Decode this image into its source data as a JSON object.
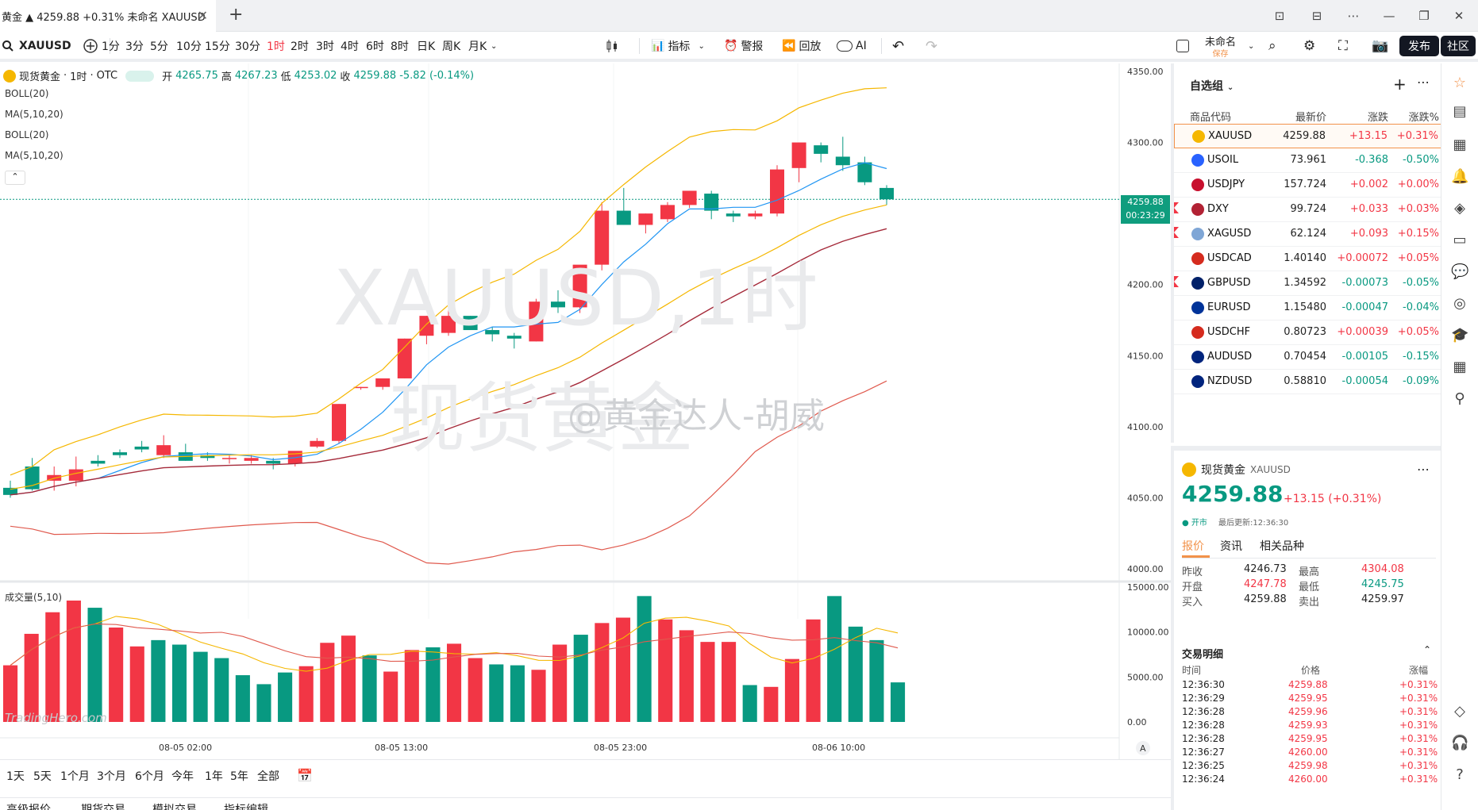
{
  "tab": {
    "title": "黄金 ▲ 4259.88 +0.31% 未命名 XAUUSD",
    "new_tab": "+",
    "close": "✕"
  },
  "window_controls": [
    "⊡",
    "⊟",
    "⋯",
    "—",
    "❐",
    "✕"
  ],
  "toolbar": {
    "symbol": "XAUUSD",
    "intervals": [
      "1分",
      "3分",
      "5分",
      "10分",
      "15分",
      "30分",
      "1时",
      "2时",
      "3时",
      "4时",
      "6时",
      "8时",
      "日K",
      "周K",
      "月K"
    ],
    "active_interval": "1时",
    "indicators": "指标",
    "alert": "警报",
    "replay": "回放",
    "ai": "AI",
    "layout_name": "未命名",
    "layout_sub": "保存",
    "publish": "发布",
    "community": "社区"
  },
  "legend": {
    "name": "现货黄金",
    "interval": "1时",
    "exchange": "OTC",
    "open_label": "开",
    "open": "4265.75",
    "high_label": "高",
    "high": "4267.23",
    "low_label": "低",
    "low": "4253.02",
    "close_label": "收",
    "close": "4259.88",
    "change": "-5.82 (-0.14%)"
  },
  "indicators": [
    "BOLL(20)",
    "MA(5,10,20)",
    "BOLL(20)",
    "MA(5,10,20)"
  ],
  "watermark": {
    "line1": "XAUUSD,1时",
    "line2": "现货黄金",
    "weibo": "@黄金达人-胡威",
    "brand": "TradingHero.com"
  },
  "price_tag": {
    "price": "4259.88",
    "countdown": "00:23:29"
  },
  "volume_label": "成交量(5,10)",
  "chart_data": {
    "type": "candlestick",
    "price_axis": [
      "4350.00",
      "4300.00",
      "4250.00",
      "4200.00",
      "4150.00",
      "4100.00",
      "4050.00",
      "4000.00"
    ],
    "volume_axis": [
      "15000.00",
      "10000.00",
      "5000.00",
      "0.00"
    ],
    "time_axis": [
      "08-05 02:00",
      "08-05 13:00",
      "08-05 23:00",
      "08-06 10:00"
    ],
    "ylim": [
      4000,
      4350
    ],
    "candles": [
      [
        4057,
        4062,
        4050,
        4052
      ],
      [
        4072,
        4078,
        4055,
        4056
      ],
      [
        4062,
        4072,
        4055,
        4066
      ],
      [
        4062,
        4079,
        4058,
        4070
      ],
      [
        4076,
        4080,
        4072,
        4074
      ],
      [
        4082,
        4084,
        4078,
        4080
      ],
      [
        4086,
        4090,
        4082,
        4084
      ],
      [
        4080,
        4094,
        4078,
        4087
      ],
      [
        4082,
        4088,
        4076,
        4076
      ],
      [
        4080,
        4082,
        4076,
        4078
      ],
      [
        4078,
        4080,
        4074,
        4078
      ],
      [
        4076,
        4080,
        4074,
        4078
      ],
      [
        4076,
        4078,
        4070,
        4074
      ],
      [
        4074,
        4082,
        4072,
        4083
      ],
      [
        4086,
        4092,
        4085,
        4090
      ],
      [
        4090,
        4116,
        4088,
        4116
      ],
      [
        4128,
        4128,
        4126,
        4128
      ],
      [
        4128,
        4133,
        4126,
        4134
      ],
      [
        4134,
        4162,
        4134,
        4162
      ],
      [
        4164,
        4178,
        4158,
        4178
      ],
      [
        4166,
        4184,
        4164,
        4178
      ],
      [
        4178,
        4178,
        4170,
        4168
      ],
      [
        4168,
        4170,
        4160,
        4165
      ],
      [
        4164,
        4166,
        4155,
        4162
      ],
      [
        4160,
        4190,
        4160,
        4188
      ],
      [
        4188,
        4196,
        4180,
        4184
      ],
      [
        4184,
        4210,
        4180,
        4214
      ],
      [
        4214,
        4258,
        4210,
        4252
      ],
      [
        4252,
        4268,
        4242,
        4242
      ],
      [
        4242,
        4250,
        4236,
        4250
      ],
      [
        4246,
        4258,
        4244,
        4256
      ],
      [
        4256,
        4266,
        4254,
        4266
      ],
      [
        4264,
        4266,
        4246,
        4252
      ],
      [
        4250,
        4252,
        4244,
        4248
      ],
      [
        4248,
        4252,
        4246,
        4250
      ],
      [
        4250,
        4284,
        4248,
        4281
      ],
      [
        4282,
        4300,
        4272,
        4300
      ],
      [
        4298,
        4300,
        4286,
        4292
      ],
      [
        4290,
        4304,
        4280,
        4284
      ],
      [
        4286,
        4290,
        4270,
        4272
      ],
      [
        4268,
        4270,
        4256,
        4260
      ]
    ],
    "volumes": [
      [
        6300,
        "r"
      ],
      [
        9800,
        "r"
      ],
      [
        12200,
        "r"
      ],
      [
        13500,
        "r"
      ],
      [
        12700,
        "g"
      ],
      [
        10500,
        "r"
      ],
      [
        8400,
        "r"
      ],
      [
        9100,
        "g"
      ],
      [
        8600,
        "g"
      ],
      [
        7800,
        "g"
      ],
      [
        7100,
        "g"
      ],
      [
        5200,
        "g"
      ],
      [
        4200,
        "g"
      ],
      [
        5500,
        "g"
      ],
      [
        6200,
        "r"
      ],
      [
        8800,
        "r"
      ],
      [
        9600,
        "r"
      ],
      [
        7400,
        "g"
      ],
      [
        5600,
        "r"
      ],
      [
        8000,
        "r"
      ],
      [
        8300,
        "g"
      ],
      [
        8700,
        "r"
      ],
      [
        7100,
        "r"
      ],
      [
        6400,
        "g"
      ],
      [
        6300,
        "g"
      ],
      [
        5800,
        "r"
      ],
      [
        8600,
        "r"
      ],
      [
        9700,
        "g"
      ],
      [
        11000,
        "r"
      ],
      [
        11600,
        "r"
      ],
      [
        14000,
        "g"
      ],
      [
        11400,
        "r"
      ],
      [
        10200,
        "r"
      ],
      [
        8900,
        "r"
      ],
      [
        8900,
        "r"
      ],
      [
        4100,
        "g"
      ],
      [
        3900,
        "r"
      ],
      [
        7000,
        "r"
      ],
      [
        11400,
        "r"
      ],
      [
        14000,
        "g"
      ],
      [
        10600,
        "g"
      ],
      [
        9100,
        "g"
      ],
      [
        4400,
        "g"
      ]
    ]
  },
  "range_bar": [
    "1天",
    "5天",
    "1个月",
    "3个月",
    "6个月",
    "今年",
    "1年",
    "5年",
    "全部"
  ],
  "bottom_tabs": [
    "高级报价",
    "期货交易",
    "模拟交易",
    "指标编辑"
  ],
  "watchlist": {
    "title": "自选组",
    "headers": [
      "商品代码",
      "最新价",
      "涨跌",
      "涨跌%"
    ],
    "rows": [
      {
        "sym": "XAUUSD",
        "price": "4259.88",
        "chg": "+13.15",
        "pct": "+0.31%",
        "up": true,
        "flag": false,
        "color": "#f5b700"
      },
      {
        "sym": "USOIL",
        "price": "73.961",
        "chg": "-0.368",
        "pct": "-0.50%",
        "up": false,
        "flag": false,
        "color": "#2962ff"
      },
      {
        "sym": "USDJPY",
        "price": "157.724",
        "chg": "+0.002",
        "pct": "+0.00%",
        "up": true,
        "flag": false,
        "color": "#c8102e"
      },
      {
        "sym": "DXY",
        "price": "99.724",
        "chg": "+0.033",
        "pct": "+0.03%",
        "up": true,
        "flag": true,
        "color": "#b22234"
      },
      {
        "sym": "XAGUSD",
        "price": "62.124",
        "chg": "+0.093",
        "pct": "+0.15%",
        "up": true,
        "flag": true,
        "color": "#7fa6d6"
      },
      {
        "sym": "USDCAD",
        "price": "1.40140",
        "chg": "+0.00072",
        "pct": "+0.05%",
        "up": true,
        "flag": false,
        "color": "#d52b1e"
      },
      {
        "sym": "GBPUSD",
        "price": "1.34592",
        "chg": "-0.00073",
        "pct": "-0.05%",
        "up": false,
        "flag": true,
        "color": "#012169"
      },
      {
        "sym": "EURUSD",
        "price": "1.15480",
        "chg": "-0.00047",
        "pct": "-0.04%",
        "up": false,
        "flag": false,
        "color": "#003399"
      },
      {
        "sym": "USDCHF",
        "price": "0.80723",
        "chg": "+0.00039",
        "pct": "+0.05%",
        "up": true,
        "flag": false,
        "color": "#d52b1e"
      },
      {
        "sym": "AUDUSD",
        "price": "0.70454",
        "chg": "-0.00105",
        "pct": "-0.15%",
        "up": false,
        "flag": false,
        "color": "#00247d"
      },
      {
        "sym": "NZDUSD",
        "price": "0.58810",
        "chg": "-0.00054",
        "pct": "-0.09%",
        "up": false,
        "flag": false,
        "color": "#00247d"
      }
    ]
  },
  "detail": {
    "name": "现货黄金",
    "symbol": "XAUUSD",
    "price": "4259.88",
    "change": "+13.15 (+0.31%)",
    "status": "● 开市",
    "updated": "最后更新:12:36:30",
    "tabs": [
      "报价",
      "资讯",
      "相关品种"
    ],
    "stats": [
      {
        "l": "昨收",
        "v": "4246.73",
        "l2": "最高",
        "v2": "4304.08"
      },
      {
        "l": "开盘",
        "v": "4247.78",
        "l2": "最低",
        "v2": "4245.75"
      },
      {
        "l": "买入",
        "v": "4259.88",
        "l2": "卖出",
        "v2": "4259.97"
      }
    ],
    "trades_title": "交易明细",
    "trades_head": [
      "时间",
      "价格",
      "涨幅"
    ],
    "trades": [
      [
        "12:36:30",
        "4259.88",
        "+0.31%"
      ],
      [
        "12:36:29",
        "4259.95",
        "+0.31%"
      ],
      [
        "12:36:28",
        "4259.96",
        "+0.31%"
      ],
      [
        "12:36:28",
        "4259.93",
        "+0.31%"
      ],
      [
        "12:36:28",
        "4259.95",
        "+0.31%"
      ],
      [
        "12:36:27",
        "4260.00",
        "+0.31%"
      ],
      [
        "12:36:25",
        "4259.98",
        "+0.31%"
      ],
      [
        "12:36:24",
        "4260.00",
        "+0.31%"
      ]
    ]
  }
}
